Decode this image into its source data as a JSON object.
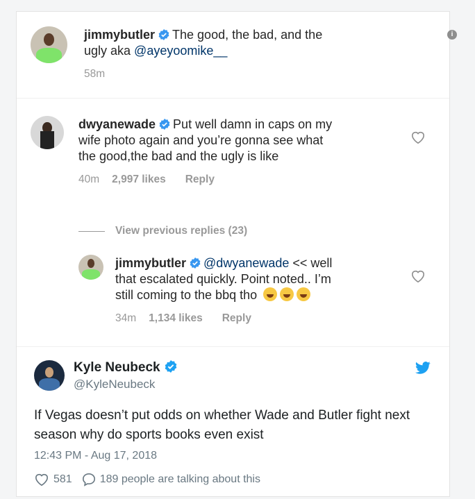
{
  "post": {
    "username": "jimmybutler",
    "caption_line1": "The good, the bad, and the",
    "caption_line2_pre": "ugly aka ",
    "caption_mention": "@ayeyoomike__",
    "time": "58m"
  },
  "comment1": {
    "username": "dwyanewade",
    "line1": "Put well damn in caps on my",
    "line2": "wife photo again and you’re gonna see what",
    "line3": "the good,the bad and the ugly is like",
    "time": "40m",
    "likes": "2,997 likes",
    "reply": "Reply"
  },
  "view_previous": "View previous replies (23)",
  "comment2": {
    "username": "jimmybutler",
    "mention": "@dwyanewade",
    "line1_rest": " << well",
    "line2": "that escalated quickly. Point noted.. I’m",
    "line3": "still coming to the bbq tho",
    "time": "34m",
    "likes": "1,134 likes",
    "reply": "Reply"
  },
  "tweet": {
    "name": "Kyle Neubeck",
    "handle": "@KyleNeubeck",
    "text": "If Vegas doesn’t put odds on whether Wade and Butler fight next season why do sports books even exist",
    "timestamp": "12:43 PM - Aug 17, 2018",
    "likes": "581",
    "talking": "189 people are talking about this"
  },
  "colors": {
    "verified": "#3897f0",
    "twitter": "#1da1f2",
    "muted": "#999999"
  }
}
